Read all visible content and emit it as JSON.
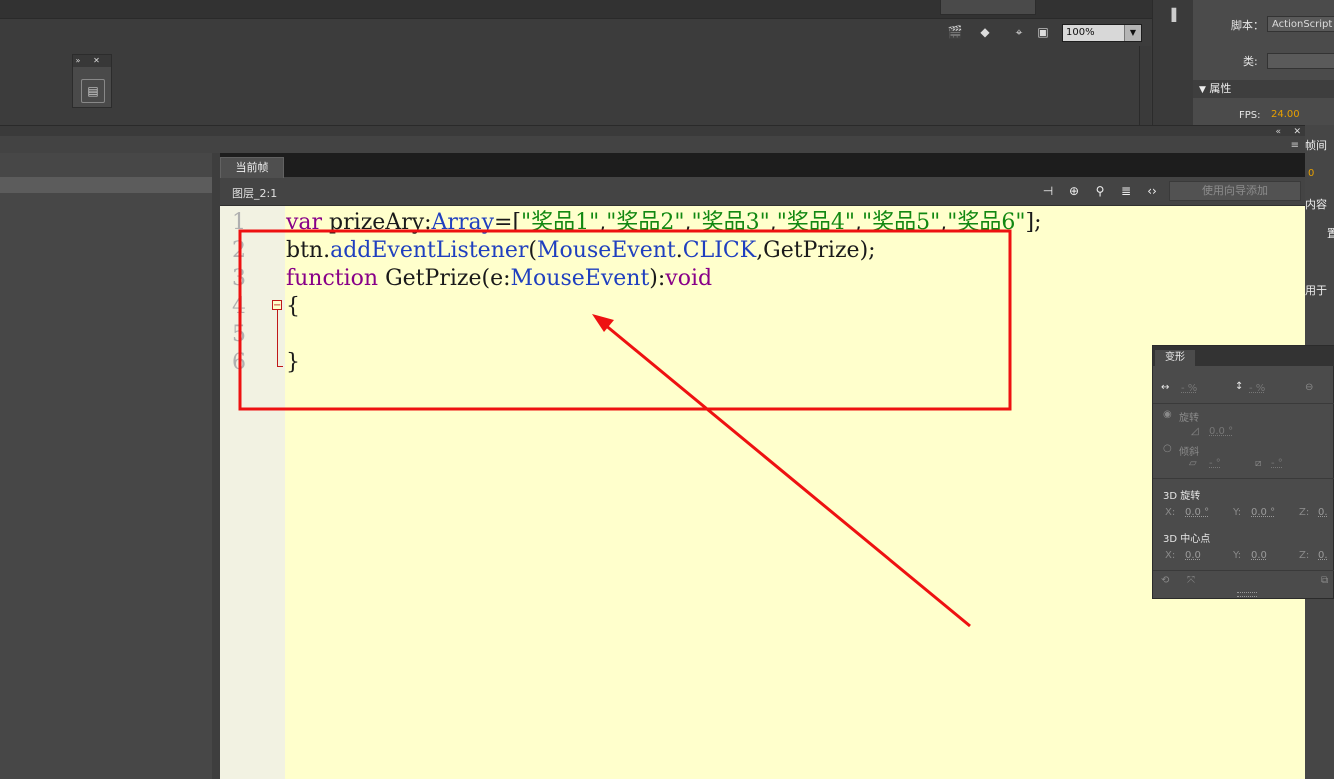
{
  "toolbar": {
    "zoom": "100%"
  },
  "properties": {
    "script_label": "脚本：",
    "script_value": "ActionScript",
    "class_label": "类:",
    "section_label": "属性",
    "fps_label": "FPS:",
    "fps_value": "24.00",
    "frag1": "帧间",
    "frag2": "0",
    "frag3": "内容",
    "frag4": "用于",
    "frag5": "置"
  },
  "actions": {
    "tab_label": "当前帧",
    "path": "图层_2:1",
    "wizard_label": "使用向导添加",
    "lines": [
      "1",
      "2",
      "3",
      "4",
      "5",
      "6"
    ]
  },
  "transform": {
    "tab": "变形",
    "width_pct": "- %",
    "height_pct": "- %",
    "rotate_label": "旋转",
    "rotate_value": "0.0 °",
    "skew_label": "倾斜",
    "skew_x": "- °",
    "skew_y": "- °",
    "rot3d_label": "3D 旋转",
    "rot3d": {
      "x_label": "X:",
      "x": "0.0 °",
      "y_label": "Y:",
      "y": "0.0 °",
      "z_label": "Z:",
      "z": "0."
    },
    "center3d_label": "3D 中心点",
    "center3d": {
      "x_label": "X:",
      "x": "0.0",
      "y_label": "Y:",
      "y": "0.0",
      "z_label": "Z:",
      "z": "0."
    }
  },
  "colors": {
    "editor_bg": "#ffffcc",
    "annotation": "#ee1111",
    "fps": "#e8a000"
  }
}
